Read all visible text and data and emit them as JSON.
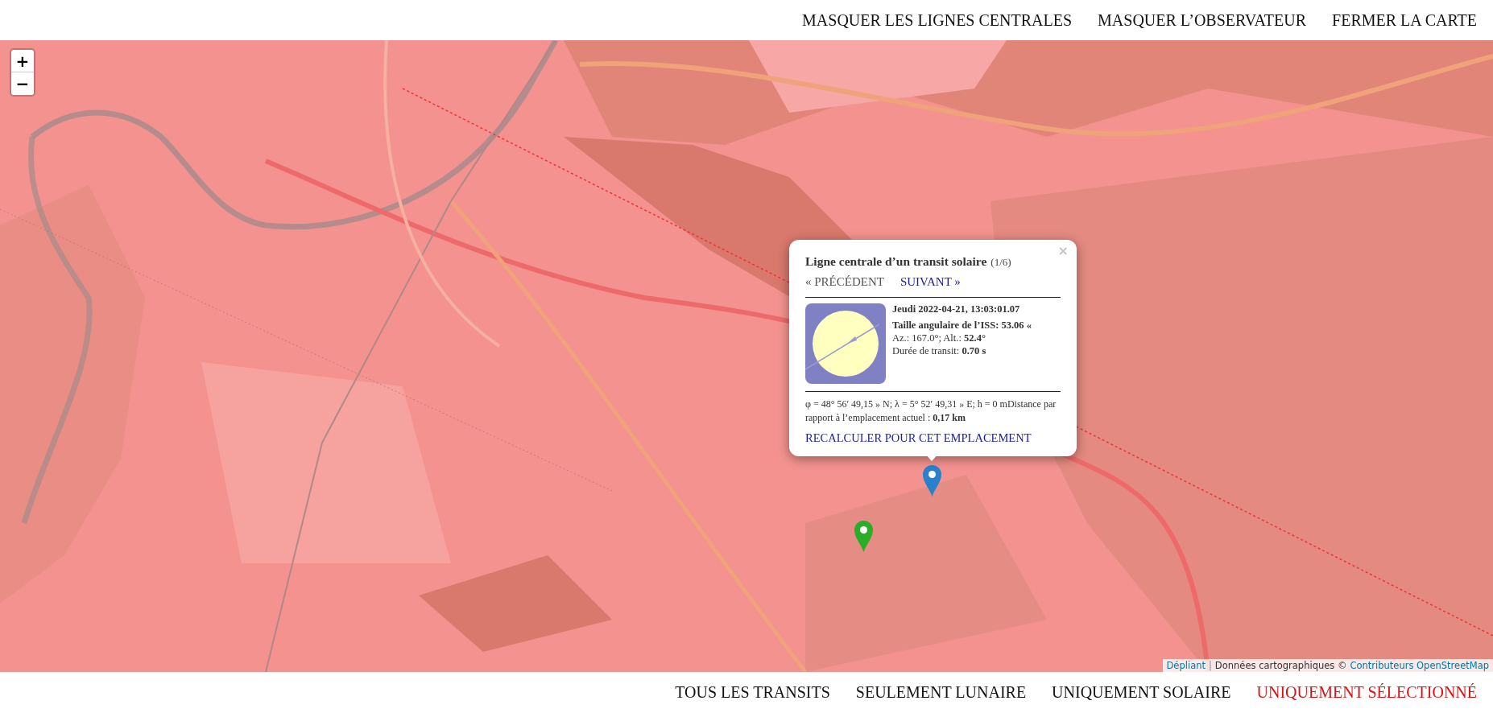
{
  "top_nav": [
    {
      "label": "MASQUER LES LIGNES CENTRALES"
    },
    {
      "label": "MASQUER L’OBSERVATEUR"
    },
    {
      "label": "FERMER LA CARTE"
    }
  ],
  "map": {
    "zoom_in": "+",
    "zoom_out": "−",
    "markers": [
      {
        "color": "#2a81cb"
      },
      {
        "color": "#2aad27"
      }
    ],
    "popup": {
      "close": "×",
      "title": "Ligne centrale d’un transit solaire",
      "count": "(1/6)",
      "previous": {
        "label": "« PRÉCÉDENT",
        "disabled": true
      },
      "next": {
        "label": "SUIVANT »",
        "disabled": false
      },
      "date": "Jeudi 2022-04-21, 13:03:01.07",
      "details": [
        "Taille angulaire de l’ISS: 53.06 «",
        "Az.: 167.0°; Alt.: **52.4°**",
        "Durée de transit: **0.70 s**"
      ],
      "location": "φ = 48° 56′ 49,15 » N; λ = 5° 52′ 49,31 » E; h = 0 mDistance par rapport à l’emplacement actuel : **0,17 km**",
      "action": "RECALCULER POUR CET EMPLACEMENT"
    },
    "attribution": {
      "library": "Dépliant",
      "separator": "|",
      "text": "Données cartographiques ©",
      "source": "Contributeurs OpenStreetMap"
    }
  },
  "filters": [
    {
      "label": "TOUS LES TRANSITS",
      "selected": false
    },
    {
      "label": "SEULEMENT LUNAIRE",
      "selected": false
    },
    {
      "label": "UNIQUEMENT SOLAIRE",
      "selected": false
    },
    {
      "label": "UNIQUEMENT SÉLECTIONNÉ",
      "selected": true
    }
  ]
}
